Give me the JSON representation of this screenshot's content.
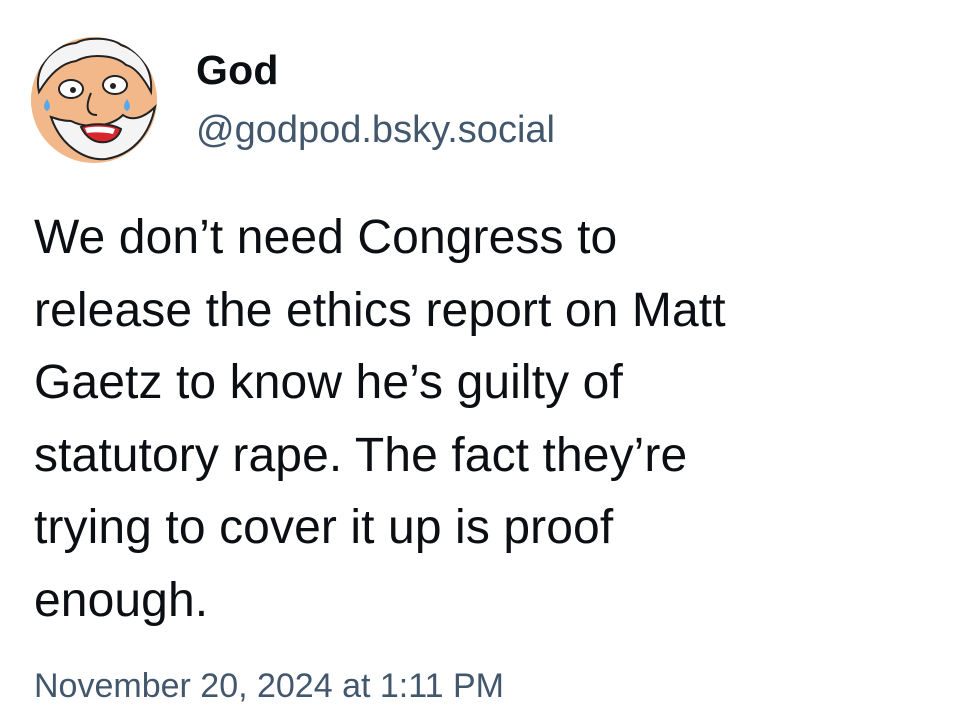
{
  "author": {
    "display_name": "God",
    "handle": "@godpod.bsky.social",
    "avatar_icon": "cartoon-god-avatar"
  },
  "post": {
    "text_lines": [
      "We don’t need Congress to",
      "release the ethics report on Matt",
      "Gaetz to know he’s guilty of",
      "statutory rape. The fact they’re",
      "trying to cover it up is proof",
      "enough."
    ],
    "timestamp": "November 20, 2024 at 1:11 PM"
  },
  "colors": {
    "text": "#0b0f14",
    "secondary_text": "#42576c",
    "background": "#ffffff"
  }
}
